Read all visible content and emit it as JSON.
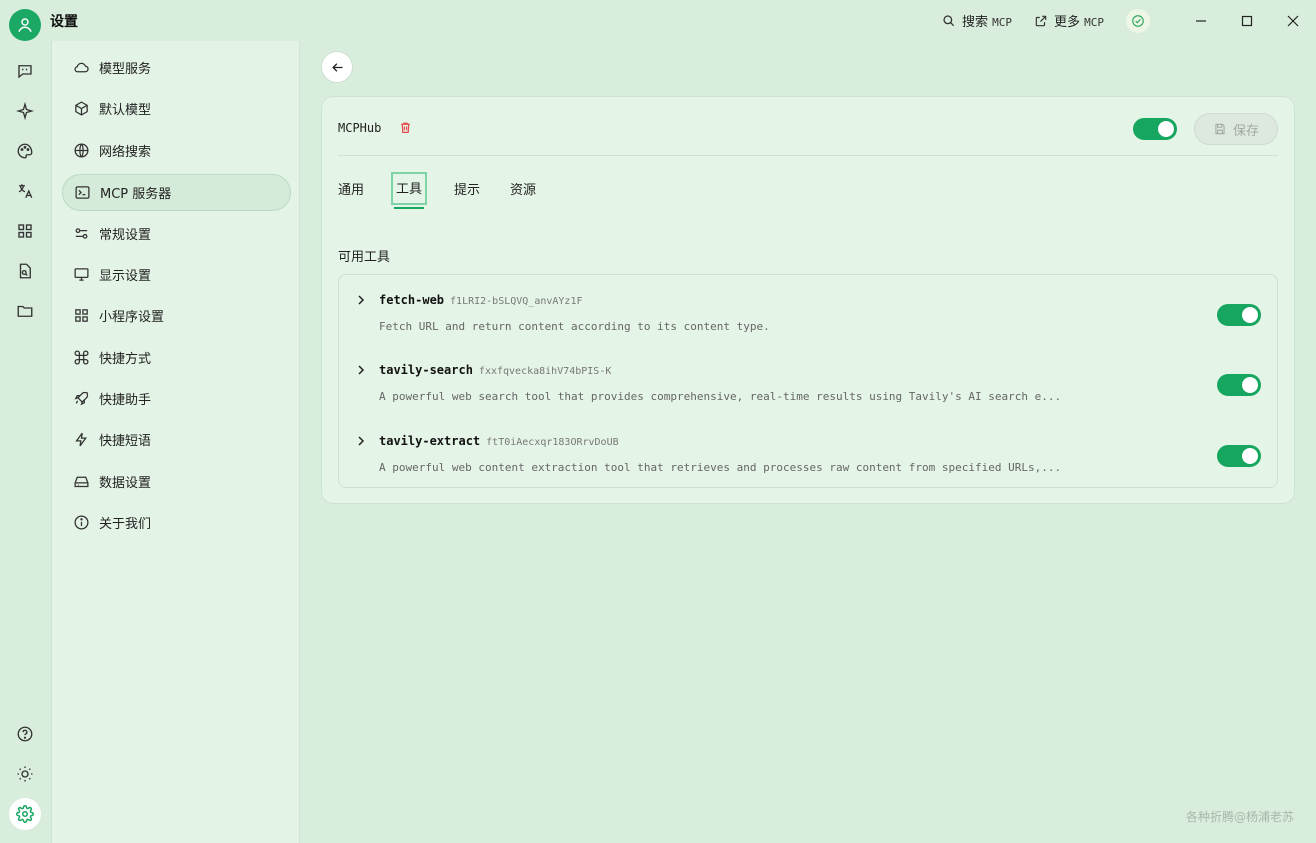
{
  "app": {
    "title": "设置"
  },
  "topbar": {
    "search_label": "搜索",
    "search_suffix": "MCP",
    "more_label": "更多",
    "more_suffix": "MCP"
  },
  "sidebar": {
    "items": [
      {
        "label": "模型服务",
        "icon": "cloud-icon"
      },
      {
        "label": "默认模型",
        "icon": "cube-icon"
      },
      {
        "label": "网络搜索",
        "icon": "globe-icon"
      },
      {
        "label": "MCP 服务器",
        "icon": "terminal-icon"
      },
      {
        "label": "常规设置",
        "icon": "sliders-icon"
      },
      {
        "label": "显示设置",
        "icon": "monitor-icon"
      },
      {
        "label": "小程序设置",
        "icon": "grid-icon"
      },
      {
        "label": "快捷方式",
        "icon": "command-icon"
      },
      {
        "label": "快捷助手",
        "icon": "rocket-icon"
      },
      {
        "label": "快捷短语",
        "icon": "zap-icon"
      },
      {
        "label": "数据设置",
        "icon": "drive-icon"
      },
      {
        "label": "关于我们",
        "icon": "info-icon"
      }
    ],
    "active_index": 3
  },
  "server": {
    "name": "MCPHub",
    "enabled": true,
    "save_label": "保存"
  },
  "tabs": [
    "通用",
    "工具",
    "提示",
    "资源"
  ],
  "active_tab": 1,
  "tools_section": {
    "title": "可用工具",
    "tools": [
      {
        "name": "fetch-web",
        "id": "f1LRI2-bSLQVQ_anvAYz1F",
        "description": "Fetch URL and return content according to its content type.",
        "enabled": true
      },
      {
        "name": "tavily-search",
        "id": "fxxfqvecka8ihV74bPIS-K",
        "description": "A powerful web search tool that provides comprehensive, real-time results using Tavily's AI search e...",
        "enabled": true
      },
      {
        "name": "tavily-extract",
        "id": "ftT0iAecxqr183ORrvDoUB",
        "description": "A powerful web content extraction tool that retrieves and processes raw content from specified URLs,...",
        "enabled": true
      }
    ]
  },
  "watermark": "各种折腾@杨浦老苏",
  "colors": {
    "accent": "#17a660",
    "background": "#d8eddc",
    "sidebar": "#e3f3e6",
    "danger": "#e5484d"
  }
}
